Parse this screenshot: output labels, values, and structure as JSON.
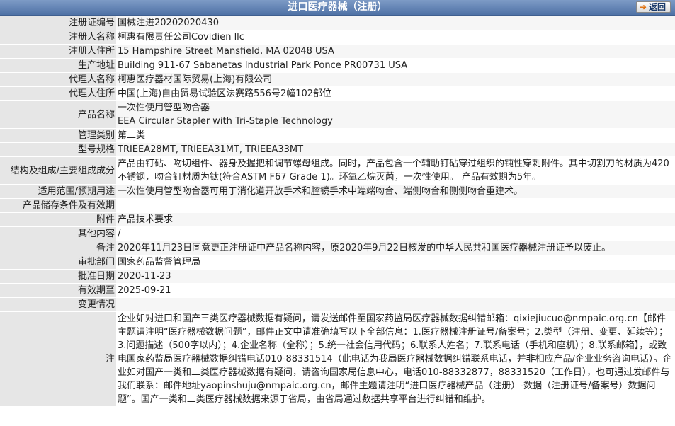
{
  "header": {
    "title": "进口医疗器械（注册）",
    "back_label": "返回"
  },
  "rows": [
    {
      "label": "注册证编号",
      "value": "国械注进20202020430"
    },
    {
      "label": "注册人名称",
      "value": "柯惠有限责任公司Covidien llc"
    },
    {
      "label": "注册人住所",
      "value": "15 Hampshire Street Mansfield, MA 02048 USA"
    },
    {
      "label": "生产地址",
      "value": "Building 911-67 Sabanetas Industrial Park Ponce PR00731 USA"
    },
    {
      "label": "代理人名称",
      "value": "柯惠医疗器材国际贸易(上海)有限公司"
    },
    {
      "label": "代理人住所",
      "value": "中国(上海)自由贸易试验区法赛路556号2幢102部位"
    },
    {
      "label": "产品名称",
      "value_lines": [
        "一次性使用管型吻合器",
        "EEA Circular Stapler with Tri-Staple Technology"
      ]
    },
    {
      "label": "管理类别",
      "value": "第二类"
    },
    {
      "label": "型号规格",
      "value": "TRIEEA28MT, TRIEEA31MT, TRIEEA33MT"
    },
    {
      "label": "结构及组成/主要组成成分",
      "value": "产品由钉砧、吻切组件、器身及握把和调节螺母组成。同时，产品包含一个辅助钉砧穿过组织的钝性穿刺附件。其中切割刀的材质为420不锈钢，吻合钉材质为钛(符合ASTM F67 Grade 1)。环氧乙烷灭菌，一次性使用。 产品有效期为5年。"
    },
    {
      "label": "适用范围/预期用途",
      "value": "一次性使用管型吻合器可用于消化道开放手术和腔镜手术中端端吻合、端侧吻合和侧侧吻合重建术。"
    },
    {
      "label": "产品储存条件及有效期",
      "value": ""
    },
    {
      "label": "附件",
      "value": "产品技术要求"
    },
    {
      "label": "其他内容",
      "value": "/"
    },
    {
      "label": "备注",
      "value": "2020年11月23日同意更正注册证中产品名称内容，原2020年9月22日核发的中华人民共和国医疗器械注册证予以废止。"
    },
    {
      "label": "审批部门",
      "value": "国家药品监督管理局"
    },
    {
      "label": "批准日期",
      "value": "2020-11-23"
    },
    {
      "label": "有效期至",
      "value": "2025-09-21"
    },
    {
      "label": "变更情况",
      "value": ""
    }
  ],
  "note": {
    "label": "注",
    "text": "企业如对进口和国产三类医疗器械数据有疑问，请发送邮件至国家药监局医疗器械数据纠错邮箱：qixiejiucuo@nmpaic.org.cn【邮件主题请注明“医疗器械数据问题”，邮件正文中请准确填写以下全部信息：1.医疗器械注册证号/备案号；2.类型（注册、变更、延续等）；3.问题描述（500字以内）；4.企业名称（全称）；5.统一社会信用代码；6.联系人姓名；7.联系电话（手机和座机）；8.联系邮箱】，或致电国家药监局医疗器械数据纠错电话010-88331514（此电话为我局医疗器械数据纠错联系电话，并非相应产品/企业业务咨询电话）。企业如对国产一类和二类医疗器械数据有疑问，请咨询国家局信息中心，电话010-88332877，88331520（工作日），也可通过发邮件与我们联系：邮件地址yaopinshuju@nmpaic.org.cn，邮件主题请注明“进口医疗器械产品（注册）-数据（注册证号/备案号）数据问题”。国产一类和二类医疗器械数据来源于省局，由省局通过数据共享平台进行纠错和维护。"
  }
}
